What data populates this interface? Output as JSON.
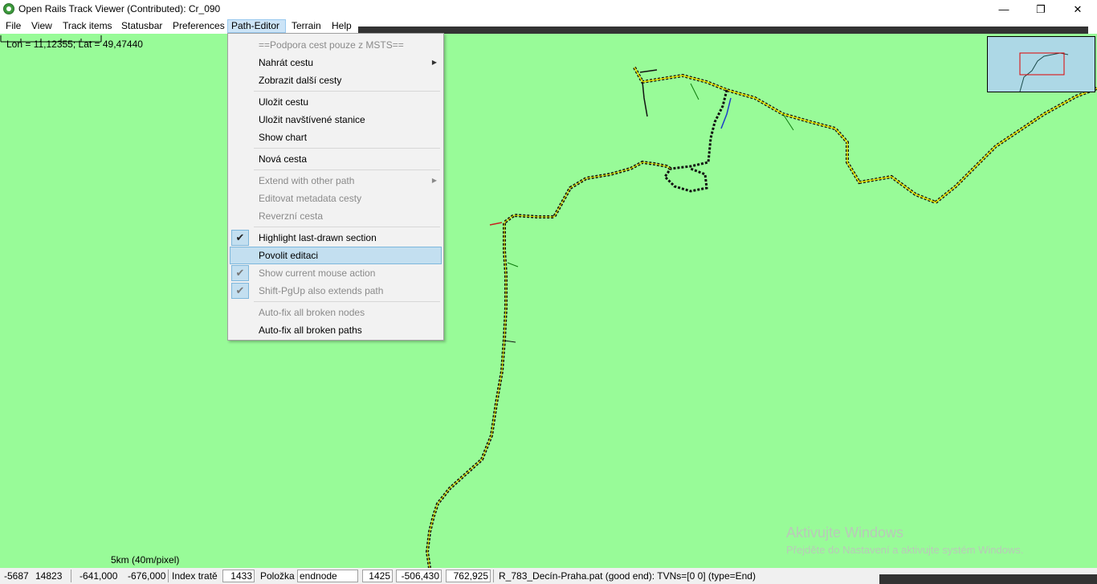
{
  "window": {
    "title": "Open Rails Track Viewer (Contributed): Cr_090",
    "minimize_glyph": "—",
    "maximize_glyph": "❐",
    "close_glyph": "✕"
  },
  "menubar": {
    "items": [
      "File",
      "View",
      "Track items",
      "Statusbar",
      "Preferences",
      "Path-Editor",
      "Terrain",
      "Help"
    ],
    "active": "Path-Editor"
  },
  "map": {
    "coords": "Lon = 11,12355; Lat = 49,47440",
    "scale_label": "5km (40m/pixel)",
    "background_color": "#98fb98",
    "overview_color": "#add8e6",
    "watermark_title": "Aktivujte Windows",
    "watermark_sub": "Přejděte do Nastavení a aktivujte systém Windows."
  },
  "path_editor_menu": {
    "items": [
      {
        "label": "==Podpora cest pouze z MSTS==",
        "disabled": true
      },
      {
        "label": "Nahrát cestu",
        "submenu": true
      },
      {
        "label": "Zobrazit další cesty"
      },
      {
        "label": "Uložit cestu"
      },
      {
        "label": "Uložit navštívené stanice"
      },
      {
        "label": "Show chart"
      },
      {
        "label": "Nová cesta"
      },
      {
        "label": "Extend with other path",
        "disabled": true,
        "submenu": true
      },
      {
        "label": "Editovat metadata cesty",
        "disabled": true
      },
      {
        "label": "Reverzní cesta",
        "disabled": true
      },
      {
        "label": "Highlight last-drawn section",
        "checked": true
      },
      {
        "label": "Povolit editaci",
        "highlighted": true
      },
      {
        "label": "Show current mouse action",
        "disabled": true,
        "checked": true
      },
      {
        "label": "Shift-PgUp also extends path",
        "disabled": true,
        "checked": true
      },
      {
        "label": "Auto-fix all broken nodes",
        "disabled": true
      },
      {
        "label": "Auto-fix all broken paths"
      }
    ]
  },
  "statusbar": {
    "tile_x": "-5687",
    "tile_z": "14823",
    "world_x": "-641,000",
    "world_z": "-676,000",
    "index_label": "Index tratě",
    "index_value": "1433",
    "item_label": "Položka",
    "item_value": "endnode",
    "node_value": "1425",
    "pos_x": "-506,430",
    "pos_z": "762,925",
    "path_info": "R_783_Decín-Praha.pat (good end): TVNs=[0 0] (type=End)"
  }
}
